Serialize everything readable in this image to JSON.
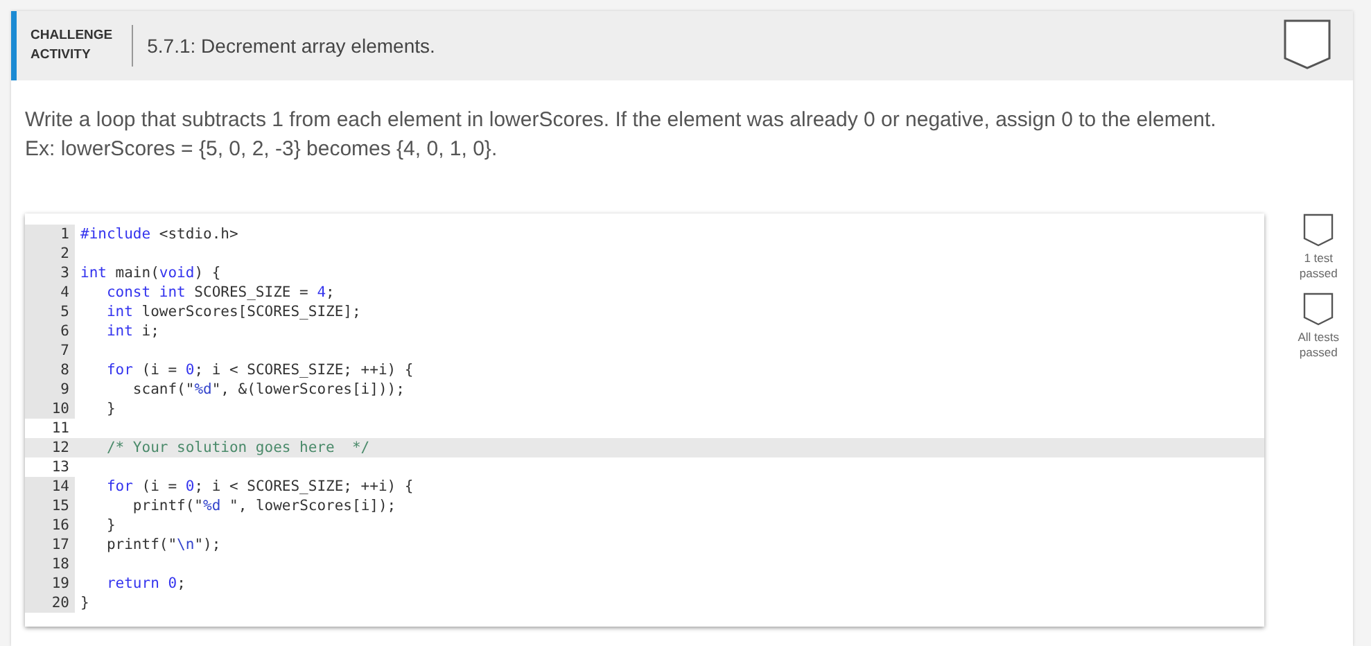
{
  "header": {
    "label_lines": [
      "CHALLENGE",
      "ACTIVITY"
    ],
    "title": "5.7.1: Decrement array elements."
  },
  "instructions": [
    "Write a loop that subtracts 1 from each element in lowerScores. If the element was already 0 or negative, assign 0 to the element.",
    "Ex: lowerScores = {5, 0, 2, -3} becomes {4, 0, 1, 0}."
  ],
  "code_lines": [
    {
      "number": "1",
      "editable": false,
      "current": false,
      "segments": [
        {
          "kind": "keyword",
          "text": "#include"
        },
        {
          "kind": "text",
          "text": " <stdio.h>"
        }
      ]
    },
    {
      "number": "2",
      "editable": false,
      "current": false
    },
    {
      "number": "3",
      "editable": false,
      "current": false,
      "segments": [
        {
          "kind": "keyword",
          "text": "int"
        },
        {
          "kind": "text",
          "text": " main("
        },
        {
          "kind": "keyword",
          "text": "void"
        },
        {
          "kind": "text",
          "text": ") {"
        }
      ]
    },
    {
      "number": "4",
      "editable": false,
      "current": false,
      "segments": [
        {
          "kind": "keyword",
          "text": "   const int"
        },
        {
          "kind": "text",
          "text": " SCORES_SIZE = "
        },
        {
          "kind": "number",
          "text": "4"
        },
        {
          "kind": "text",
          "text": ";"
        }
      ]
    },
    {
      "number": "5",
      "editable": false,
      "current": false,
      "segments": [
        {
          "kind": "keyword",
          "text": "   int"
        },
        {
          "kind": "text",
          "text": " lowerScores[SCORES_SIZE];"
        }
      ]
    },
    {
      "number": "6",
      "editable": false,
      "current": false,
      "segments": [
        {
          "kind": "keyword",
          "text": "   int"
        },
        {
          "kind": "text",
          "text": " i;"
        }
      ]
    },
    {
      "number": "7",
      "editable": false,
      "current": false
    },
    {
      "number": "8",
      "editable": false,
      "current": false,
      "segments": [
        {
          "kind": "keyword",
          "text": "   for"
        },
        {
          "kind": "text",
          "text": " (i = "
        },
        {
          "kind": "number",
          "text": "0"
        },
        {
          "kind": "text",
          "text": "; i < SCORES_SIZE; ++i) {"
        }
      ]
    },
    {
      "number": "9",
      "editable": false,
      "current": false,
      "segments": [
        {
          "kind": "text",
          "text": "      scanf(\""
        },
        {
          "kind": "escape",
          "text": "%d"
        },
        {
          "kind": "text",
          "text": "\", &(lowerScores[i]));"
        }
      ]
    },
    {
      "number": "10",
      "editable": false,
      "current": false,
      "segments": [
        {
          "kind": "text",
          "text": "   }"
        }
      ]
    },
    {
      "number": "11",
      "editable": true,
      "current": false
    },
    {
      "number": "12",
      "editable": true,
      "current": true,
      "segments": [
        {
          "kind": "comment",
          "text": "   /* Your solution goes here  */"
        }
      ]
    },
    {
      "number": "13",
      "editable": true,
      "current": false
    },
    {
      "number": "14",
      "editable": false,
      "current": false,
      "segments": [
        {
          "kind": "keyword",
          "text": "   for"
        },
        {
          "kind": "text",
          "text": " (i = "
        },
        {
          "kind": "number",
          "text": "0"
        },
        {
          "kind": "text",
          "text": "; i < SCORES_SIZE; ++i) {"
        }
      ]
    },
    {
      "number": "15",
      "editable": false,
      "current": false,
      "segments": [
        {
          "kind": "text",
          "text": "      printf(\""
        },
        {
          "kind": "escape",
          "text": "%d"
        },
        {
          "kind": "text",
          "text": " \", lowerScores[i]);"
        }
      ]
    },
    {
      "number": "16",
      "editable": false,
      "current": false,
      "segments": [
        {
          "kind": "text",
          "text": "   }"
        }
      ]
    },
    {
      "number": "17",
      "editable": false,
      "current": false,
      "segments": [
        {
          "kind": "text",
          "text": "   printf(\""
        },
        {
          "kind": "escape",
          "text": "\\n"
        },
        {
          "kind": "text",
          "text": "\");"
        }
      ]
    },
    {
      "number": "18",
      "editable": false,
      "current": false
    },
    {
      "number": "19",
      "editable": false,
      "current": false,
      "segments": [
        {
          "kind": "keyword",
          "text": "   return"
        },
        {
          "kind": "number",
          "text": " 0"
        },
        {
          "kind": "text",
          "text": ";"
        }
      ]
    },
    {
      "number": "20",
      "editable": false,
      "current": false,
      "segments": [
        {
          "kind": "text",
          "text": "}"
        }
      ]
    }
  ],
  "tests": [
    {
      "label_lines": [
        "1 test",
        "passed"
      ]
    },
    {
      "label_lines": [
        "All tests",
        "passed"
      ]
    }
  ]
}
